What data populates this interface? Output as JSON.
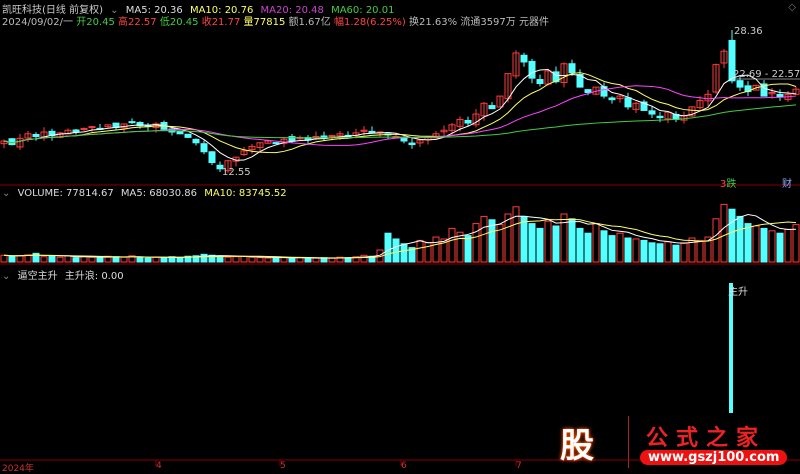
{
  "header": {
    "title": "凯旺科技(日线 前复权)",
    "ma5": "MA5: 20.36",
    "ma10": "MA10: 20.76",
    "ma20": "MA20: 20.48",
    "ma60": "MA60: 20.01",
    "date": "2024/09/02/一",
    "open_l": "开",
    "open": "20.45",
    "high_l": "高",
    "high": "22.57",
    "low_l": "低",
    "low": "20.45",
    "close_l": "收",
    "close": "21.77",
    "vol_l": "量",
    "vol": "77815",
    "amt_l": "额",
    "amt": "1.67亿",
    "chg_l": "幅",
    "chg": "1.28(6.25%)",
    "turn": "换21.63%",
    "float": "流通3597万",
    "sector": "元器件"
  },
  "annotations": {
    "max": "28.36",
    "range": "22.69 - 22.57",
    "min": "12.55",
    "tag1": "3",
    "tag2": "跌",
    "tag3": "财"
  },
  "volume_header": {
    "vol": "VOLUME: 77814.67",
    "ma5": "MA5: 68030.86",
    "ma10": "MA10: 83745.52"
  },
  "indicator": {
    "name": "逼空主升",
    "value": "主升浪: 0.00",
    "signal": "主升"
  },
  "x_axis": [
    "2024年",
    "4",
    "5",
    "6",
    "7"
  ],
  "watermark": {
    "logo": "股",
    "name": "公式之家",
    "url": "www.gszj100.com"
  },
  "colors": {
    "up": "#ff3c3c",
    "down": "#54ffff",
    "ma5": "#ffffff",
    "ma10": "#ffff66",
    "ma20": "#ff44ff",
    "ma60": "#44cc44"
  },
  "chart_data": {
    "type": "candlestick",
    "y_max": 28.36,
    "y_min": 12.55,
    "closes": [
      16.0,
      15.6,
      16.3,
      16.8,
      16.5,
      17.0,
      16.6,
      16.9,
      17.2,
      17.0,
      17.4,
      17.6,
      17.3,
      17.8,
      17.5,
      17.9,
      18.1,
      17.7,
      17.6,
      17.9,
      17.3,
      17.0,
      16.8,
      16.4,
      15.8,
      14.8,
      13.6,
      12.9,
      13.8,
      14.2,
      14.9,
      15.4,
      15.8,
      16.0,
      15.7,
      16.2,
      16.0,
      16.4,
      16.1,
      16.5,
      16.3,
      16.6,
      16.8,
      16.5,
      16.9,
      17.2,
      16.9,
      17.0,
      16.7,
      16.5,
      16.0,
      15.6,
      16.1,
      16.4,
      16.8,
      17.2,
      17.8,
      18.4,
      18.0,
      19.0,
      20.2,
      19.6,
      21.0,
      23.5,
      25.8,
      24.8,
      23.0,
      22.4,
      23.8,
      22.6,
      24.6,
      23.6,
      22.0,
      21.4,
      22.0,
      21.0,
      20.6,
      21.0,
      19.8,
      20.2,
      19.4,
      19.0,
      18.6,
      19.2,
      18.4,
      18.8,
      19.8,
      20.5,
      21.2,
      24.5,
      26.0,
      22.7,
      22.0,
      21.5,
      22.2,
      21.0,
      21.4,
      20.9,
      21.2,
      21.77
    ],
    "volumes": [
      14000,
      12000,
      13000,
      15000,
      18000,
      11000,
      12000,
      10000,
      13000,
      9000,
      11000,
      10000,
      9000,
      12000,
      11000,
      10000,
      13000,
      9000,
      8000,
      10000,
      9000,
      11000,
      9000,
      12000,
      13000,
      16000,
      14000,
      12000,
      10000,
      11000,
      12000,
      10000,
      9000,
      8000,
      9000,
      10000,
      8000,
      9000,
      7000,
      8000,
      9000,
      8000,
      10000,
      9000,
      11000,
      14000,
      12000,
      25000,
      60000,
      48000,
      38000,
      30000,
      45000,
      40000,
      52000,
      48000,
      70000,
      62000,
      55000,
      80000,
      95000,
      88000,
      78000,
      100000,
      115000,
      95000,
      80000,
      70000,
      85000,
      75000,
      100000,
      90000,
      70000,
      60000,
      80000,
      65000,
      55000,
      60000,
      50000,
      48000,
      45000,
      40000,
      38000,
      42000,
      35000,
      40000,
      50000,
      45000,
      52000,
      90000,
      120000,
      110000,
      95000,
      80000,
      75000,
      70000,
      65000,
      60000,
      68000,
      77815
    ],
    "signal_index": 91
  }
}
